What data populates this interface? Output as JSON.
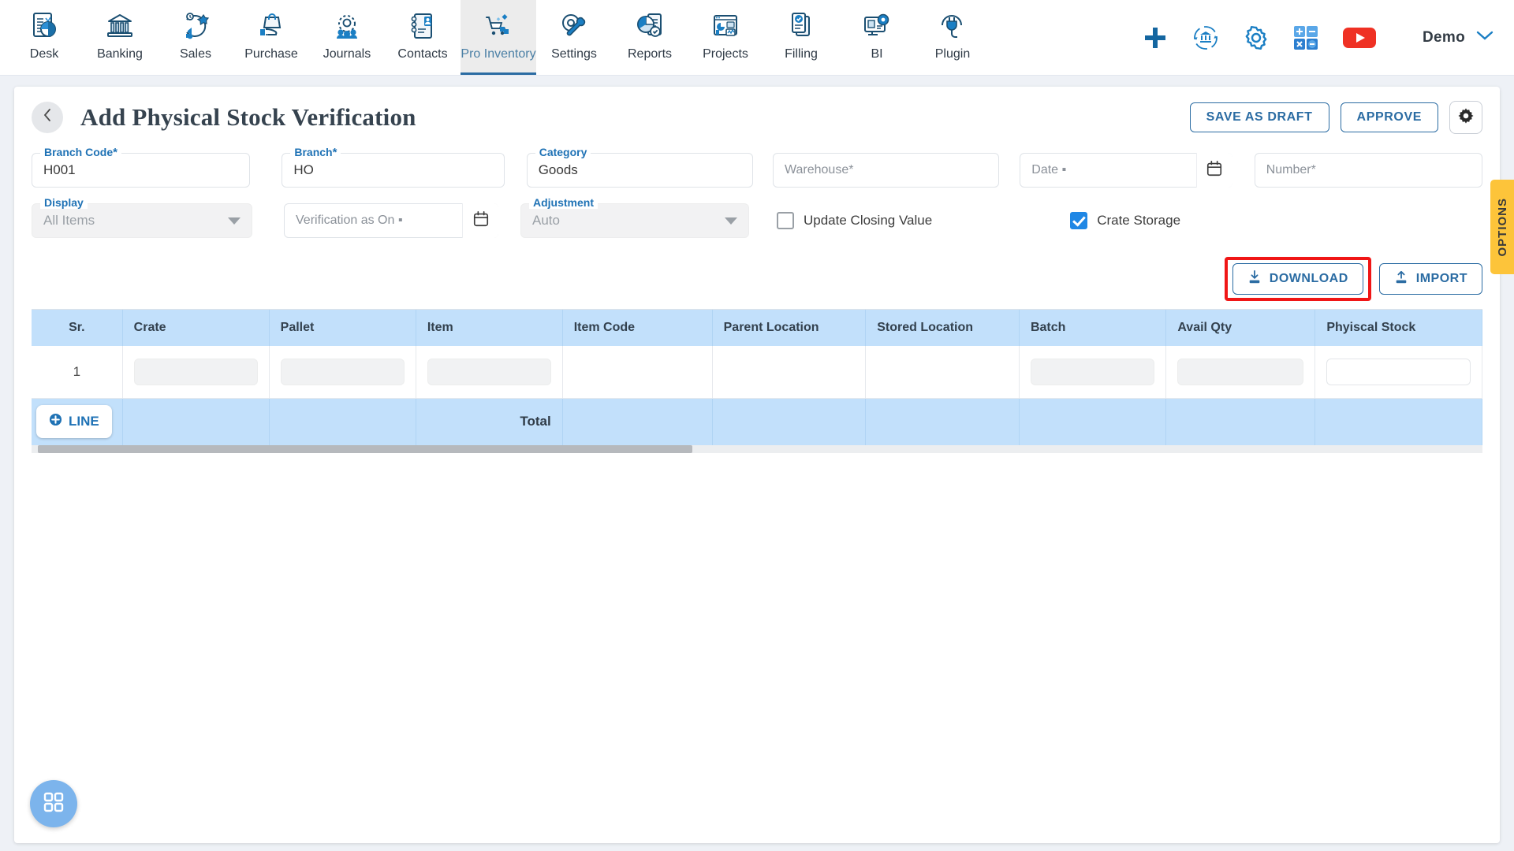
{
  "topnav": {
    "items": [
      {
        "label": "Desk",
        "icon": "desk-chart-icon",
        "active": false
      },
      {
        "label": "Banking",
        "icon": "bank-icon",
        "active": false
      },
      {
        "label": "Sales",
        "icon": "sales-megaphone-icon",
        "active": false
      },
      {
        "label": "Purchase",
        "icon": "purchase-bag-hand-icon",
        "active": false
      },
      {
        "label": "Journals",
        "icon": "journals-people-gear-icon",
        "active": false
      },
      {
        "label": "Contacts",
        "icon": "contacts-book-icon",
        "active": false
      },
      {
        "label": "Pro Inventory",
        "icon": "inventory-cart-icon",
        "active": true
      },
      {
        "label": "Settings",
        "icon": "settings-tools-icon",
        "active": false
      },
      {
        "label": "Reports",
        "icon": "reports-piechart-icon",
        "active": false
      },
      {
        "label": "Projects",
        "icon": "projects-dashboard-icon",
        "active": false
      },
      {
        "label": "Filling",
        "icon": "filling-documents-icon",
        "active": false
      },
      {
        "label": "BI",
        "icon": "bi-monitor-gear-icon",
        "active": false
      },
      {
        "label": "Plugin",
        "icon": "plugin-plug-icon",
        "active": false
      }
    ],
    "right_icons": [
      {
        "name": "add-plus-icon",
        "title": "Add"
      },
      {
        "name": "bank-sync-icon",
        "title": "Bank Sync"
      },
      {
        "name": "gear-icon",
        "title": "Settings"
      },
      {
        "name": "calculator-icon",
        "title": "Calculator"
      },
      {
        "name": "youtube-icon",
        "title": "YouTube"
      }
    ],
    "user": {
      "name": "Demo",
      "chevron": "chevron-down-icon"
    }
  },
  "header": {
    "back_icon": "chevron-left-icon",
    "title": "Add Physical Stock Verification",
    "save_draft_label": "SAVE AS DRAFT",
    "approve_label": "APPROVE",
    "settings_icon": "gear-icon"
  },
  "form": {
    "row1": [
      {
        "label": "Branch Code",
        "required": true,
        "value": "H001",
        "placeholder": "",
        "type": "text",
        "disabled": false
      },
      {
        "label": "Branch",
        "required": true,
        "value": "HO",
        "placeholder": "",
        "type": "text",
        "disabled": false
      },
      {
        "label": "Category",
        "required": false,
        "value": "Goods",
        "placeholder": "",
        "type": "text",
        "disabled": false
      },
      {
        "label": "",
        "required": true,
        "value": "",
        "placeholder": "Warehouse",
        "type": "text",
        "disabled": false
      },
      {
        "label": "",
        "required": true,
        "value": "",
        "placeholder": "Date",
        "type": "date",
        "disabled": false
      },
      {
        "label": "",
        "required": true,
        "value": "",
        "placeholder": "Number",
        "type": "text",
        "disabled": false
      }
    ],
    "row2": [
      {
        "label": "Display",
        "required": false,
        "value": "All Items",
        "placeholder": "",
        "type": "select",
        "disabled": true
      },
      {
        "label": "",
        "required": true,
        "value": "",
        "placeholder": "Verification as On",
        "type": "date",
        "disabled": false
      },
      {
        "label": "Adjustment",
        "required": false,
        "value": "Auto",
        "placeholder": "",
        "type": "select",
        "disabled": true
      }
    ],
    "checkboxes": [
      {
        "label": "Update Closing Value",
        "checked": false
      },
      {
        "label": "Crate Storage",
        "checked": true
      }
    ]
  },
  "io": {
    "download_label": "DOWNLOAD",
    "download_icon": "download-icon",
    "import_label": "IMPORT",
    "import_icon": "upload-icon",
    "highlight_color": "#f01616"
  },
  "table": {
    "columns": [
      "Sr.",
      "Crate",
      "Pallet",
      "Item",
      "Item Code",
      "Parent Location",
      "Stored Location",
      "Batch",
      "Avail Qty",
      "Phyiscal Stock"
    ],
    "rows": [
      {
        "sr": "1",
        "crate": "",
        "pallet": "",
        "item": "",
        "item_code": "",
        "parent_location": "",
        "stored_location": "",
        "batch": "",
        "avail_qty": "",
        "physical_stock": ""
      }
    ],
    "add_line_label": "LINE",
    "add_line_icon": "plus-circle-icon",
    "total_label": "Total",
    "header_bg": "#c2e0fb"
  },
  "options_tab": {
    "label": "OPTIONS",
    "color": "#fdc43a"
  },
  "fab": {
    "icon": "grid-apps-icon",
    "color": "#7cb4ec"
  }
}
